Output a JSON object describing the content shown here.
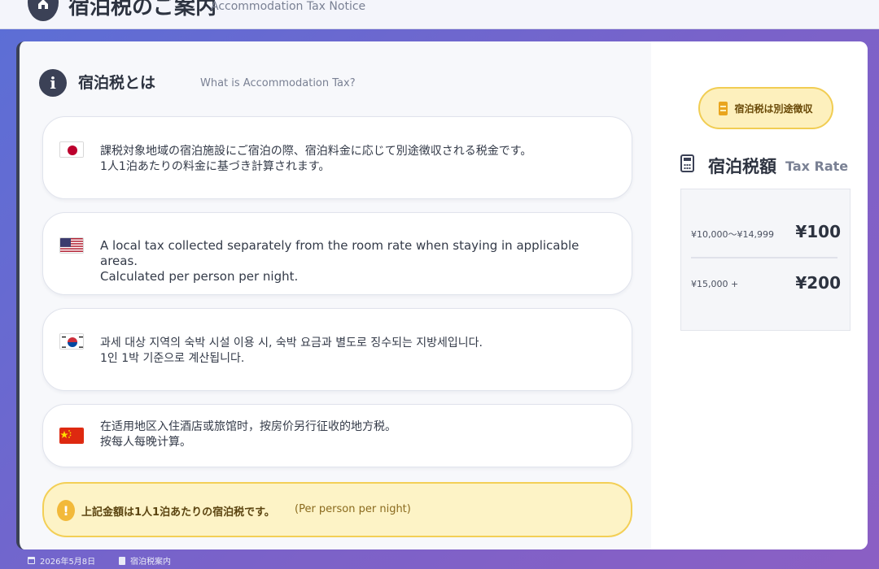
{
  "header": {
    "title": "宿泊税のご案内",
    "subtitle": "Accommodation Tax Notice"
  },
  "section": {
    "title": "宿泊税とは",
    "subtitle": "What is Accommodation Tax?"
  },
  "languages": [
    {
      "flag": "japan-flag-icon",
      "text": "課税対象地域の宿泊施設にご宿泊の際、宿泊料金に応じて別途徴収される税金です。\n1人1泊あたりの料金に基づき計算されます。"
    },
    {
      "flag": "usa-flag-icon",
      "text": "A local tax collected separately from the room rate when staying in applicable areas.\nCalculated per person per night."
    },
    {
      "flag": "korea-flag-icon",
      "text": "과세 대상 지역의 숙박 시설 이용 시, 숙박 요금과 별도로 징수되는 지방세입니다.\n1인 1박 기준으로 계산됩니다."
    },
    {
      "flag": "china-flag-icon",
      "text": "在适用地区入住酒店或旅馆时，按房价另行征收的地方税。\n按每人每晚计算。"
    }
  ],
  "notice": {
    "main": "上記金額は1人1泊あたりの宿泊税です。",
    "sub": "(Per person per night)"
  },
  "sidebar": {
    "pill_label": "宿泊税は別途徴収",
    "rate_title": "宿泊税額",
    "rate_subtitle": "Tax Rate",
    "rates": [
      {
        "range": "¥10,000〜¥14,999",
        "amount": "¥100"
      },
      {
        "range": "¥15,000 +",
        "amount": "¥200"
      }
    ]
  },
  "footer": {
    "date": "2026年5月8日",
    "doc": "宿泊税案内"
  },
  "colors": {
    "accent": "#3b4156",
    "notice_bg": "#fdf3c6",
    "notice_border": "#f3cf56",
    "background_gradient_start": "#5b6fd6",
    "background_gradient_end": "#8b5fc4"
  }
}
